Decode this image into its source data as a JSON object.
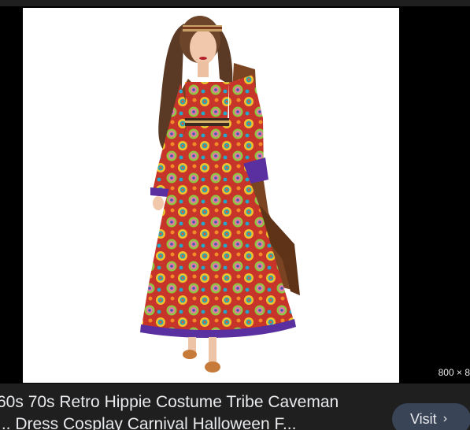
{
  "image": {
    "alt_icon": "costume-photo",
    "dimensions_label": "800 × 8"
  },
  "result": {
    "title_line1": "60s 70s Retro Hippie Costume Tribe Caveman",
    "title_line2": "... Dress Cosplay Carnival Halloween F..."
  },
  "actions": {
    "visit_label": "Visit",
    "visit_icon": "chevron-right-icon"
  },
  "colors": {
    "background": "#000000",
    "bar": "#1f1f1f",
    "button": "#394457",
    "text": "#e8eaed"
  }
}
